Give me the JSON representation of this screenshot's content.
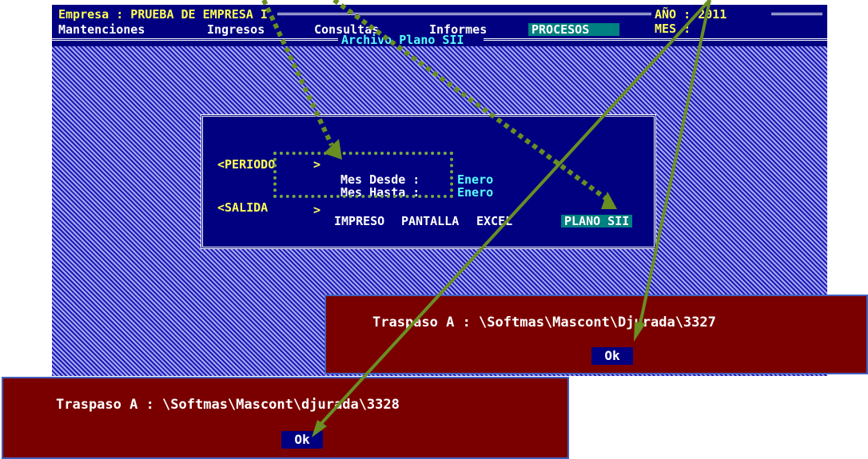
{
  "header": {
    "empresa": "Empresa : PRUEBA DE EMPRESA I",
    "ano": "AÑO : 2011",
    "mes": "MES :",
    "subtitle": "Archivo Plano SII"
  },
  "menu": {
    "items": [
      "Mantenciones",
      "Ingresos",
      "Consultas",
      "Informes",
      "PROCESOS"
    ]
  },
  "dialog": {
    "periodo_label": "<PERIODO",
    "periodo_arrow": ">",
    "mes_desde_label": "Mes Desde :",
    "mes_desde_value": "Enero",
    "mes_hasta_label": "Mes Hasta :",
    "mes_hasta_value": "Enero",
    "salida_label": "<SALIDA",
    "salida_arrow": ">",
    "options": [
      "IMPRESO",
      "PANTALLA",
      "EXCEL",
      "PLANO SII"
    ],
    "selected_option": "PLANO SII"
  },
  "popup1": {
    "message": "Traspaso A : \\Softmas\\Mascont\\Djurada\\3327",
    "ok_label": "Ok"
  },
  "popup2": {
    "message": "Traspaso A : \\Softmas\\Mascont\\djurada\\3328",
    "ok_label": "Ok"
  },
  "colors": {
    "dos_blue": "#000080",
    "highlight_teal": "#008080",
    "label_yellow": "#ffff55",
    "value_cyan": "#55ffff",
    "popup_red": "#7a0000",
    "annotation_green": "#6b8e23"
  }
}
